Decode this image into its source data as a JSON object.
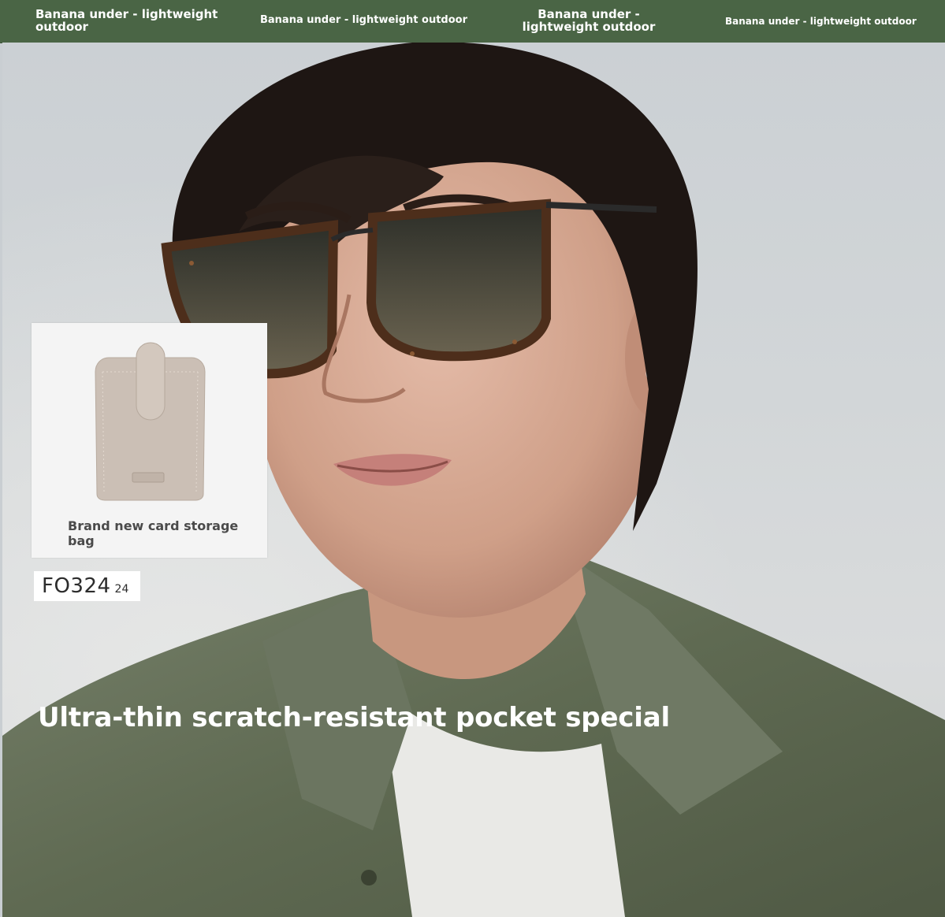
{
  "topbar": {
    "items": [
      {
        "label": "Banana under - lightweight outdoor"
      },
      {
        "label": "Banana under - lightweight outdoor"
      },
      {
        "label": "Banana under - lightweight outdoor"
      },
      {
        "label": "Banana under - lightweight outdoor"
      }
    ],
    "background": "#4a6545"
  },
  "card": {
    "caption": "Brand new card storage bag",
    "pouch_color": "#cbbfb5"
  },
  "badge": {
    "code": "FO324",
    "number": "24"
  },
  "headline": "Ultra-thin scratch-resistant pocket special",
  "colors": {
    "shirt": "#5f6b52",
    "hair": "#1f1714",
    "skin": "#d3a793",
    "tortoise": "#5a3520"
  }
}
